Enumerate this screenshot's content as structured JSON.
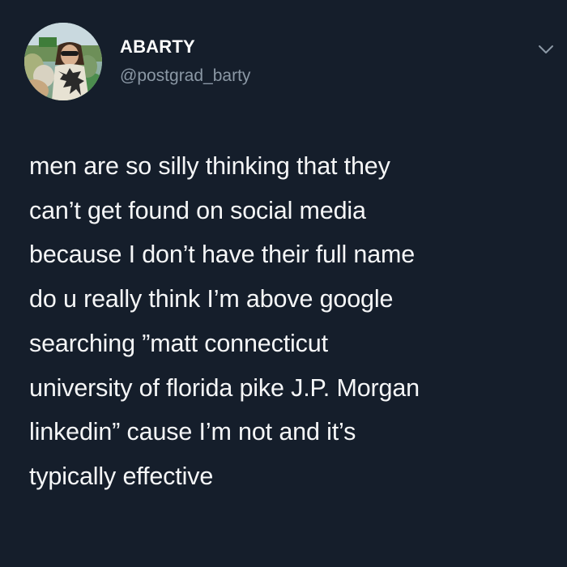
{
  "tweet": {
    "author": {
      "display_name": "ABARTY",
      "handle": "@postgrad_barty",
      "avatar_icon": "profile-photo"
    },
    "menu_icon": "chevron-down-icon",
    "text_lines": [
      "men are so silly thinking that they",
      "can’t get found on social media",
      "because I don’t have their full name",
      "do u really think I’m above google",
      "searching ”matt connecticut",
      "university of florida pike J.P. Morgan",
      "linkedin” cause I’m not and it’s",
      "typically effective"
    ]
  },
  "colors": {
    "background": "#151e2b",
    "text_primary": "#f5f6f7",
    "text_secondary": "#8b98a5"
  }
}
